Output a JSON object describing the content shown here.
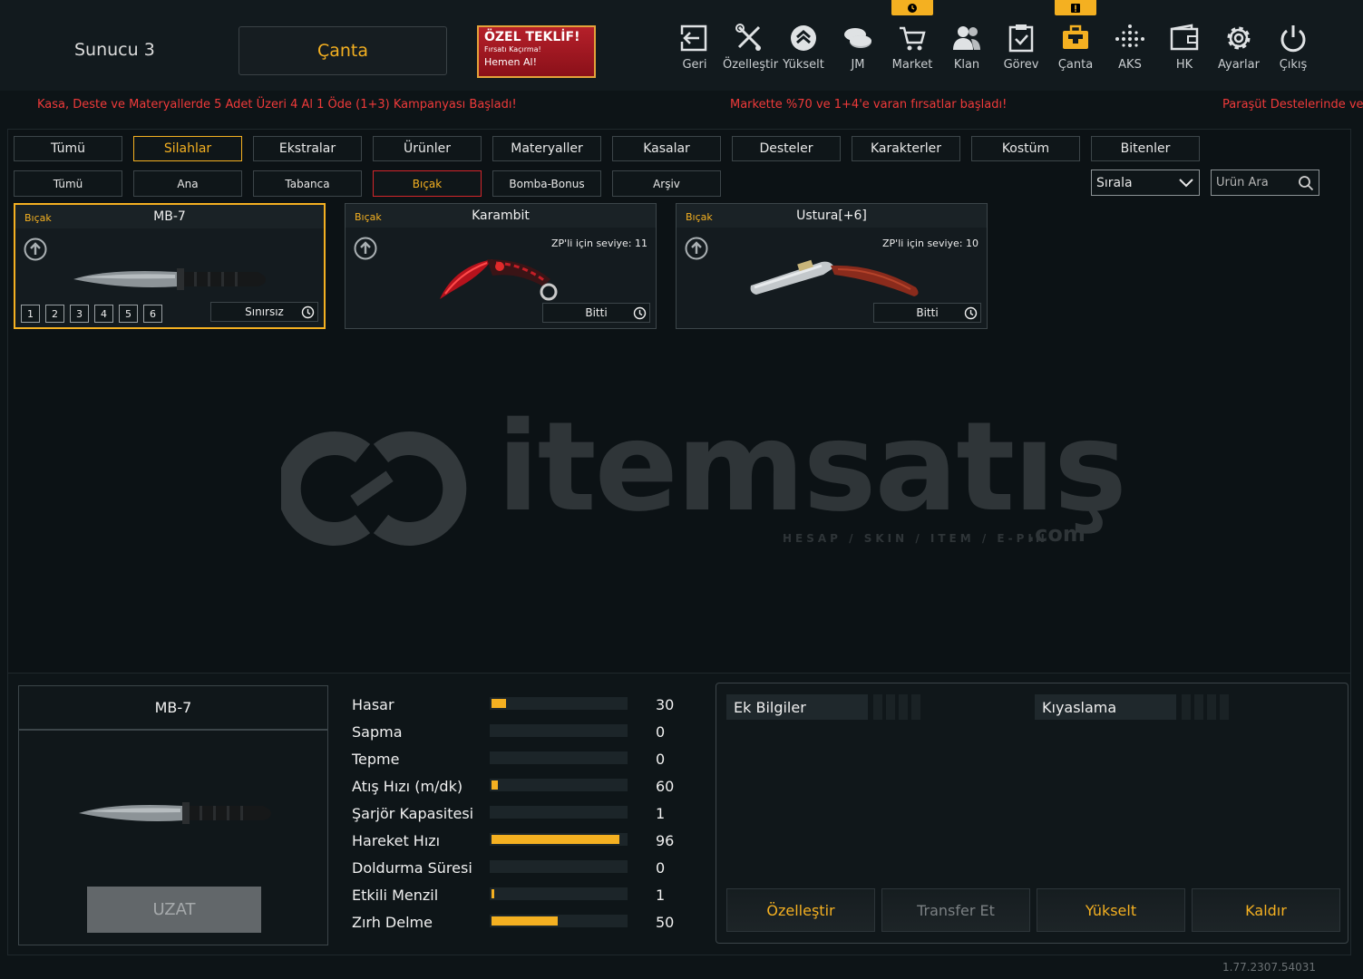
{
  "header": {
    "server": "Sunucu 3",
    "bag_title": "Çanta",
    "offer": {
      "line1": "ÖZEL TEKLİF!",
      "line2": "Fırsatı Kaçırma!",
      "line3": "Hemen Al!"
    }
  },
  "nav": [
    {
      "label": "Geri",
      "icon": "back-icon"
    },
    {
      "label": "Özelleştir",
      "icon": "tools-icon"
    },
    {
      "label": "Yükselt",
      "icon": "upgrade-icon"
    },
    {
      "label": "JM",
      "icon": "coins-icon"
    },
    {
      "label": "Market",
      "icon": "cart-icon"
    },
    {
      "label": "Klan",
      "icon": "clan-icon"
    },
    {
      "label": "Görev",
      "icon": "mission-icon"
    },
    {
      "label": "Çanta",
      "icon": "bag-icon"
    },
    {
      "label": "AKS",
      "icon": "aks-icon"
    },
    {
      "label": "HK",
      "icon": "wallet-icon"
    },
    {
      "label": "Ayarlar",
      "icon": "gear-icon"
    },
    {
      "label": "Çıkış",
      "icon": "power-icon"
    }
  ],
  "ticker": [
    "Kasa, Deste ve Materyallerde 5 Adet Üzeri 4 Al 1 Öde (1+3) Kampanyası Başladı!",
    "Markette %70 ve 1+4'e varan fırsatlar başladı!",
    "Paraşüt Destelerinde ve"
  ],
  "tabs": [
    "Tümü",
    "Silahlar",
    "Ekstralar",
    "Ürünler",
    "Materyaller",
    "Kasalar",
    "Desteler",
    "Karakterler",
    "Kostüm",
    "Bitenler"
  ],
  "subtabs": [
    "Tümü",
    "Ana",
    "Tabanca",
    "Bıçak",
    "Bomba-Bonus",
    "Arşiv"
  ],
  "sort_label": "Sırala",
  "search_placeholder": "Ürün Ara",
  "cards": [
    {
      "category": "Bıçak",
      "title": "MB-7",
      "level": "",
      "status": "Sınırsız",
      "slots": [
        "1",
        "2",
        "3",
        "4",
        "5",
        "6"
      ]
    },
    {
      "category": "Bıçak",
      "title": "Karambit",
      "level": "ZP'li için seviye: 11",
      "status": "Bitti"
    },
    {
      "category": "Bıçak",
      "title": "Ustura[+6]",
      "level": "ZP'li için seviye: 10",
      "status": "Bitti"
    }
  ],
  "watermark": {
    "brand": "itemsatış",
    "tagline": "HESAP / SKIN / ITEM / E-PIN",
    "suffix": ".com"
  },
  "preview": {
    "title": "MB-7",
    "button": "UZAT"
  },
  "stats": [
    {
      "label": "Hasar",
      "value": 30,
      "fill": 0.11
    },
    {
      "label": "Sapma",
      "value": 0,
      "fill": 0
    },
    {
      "label": "Tepme",
      "value": 0,
      "fill": 0
    },
    {
      "label": "Atış Hızı (m/dk)",
      "value": 60,
      "fill": 0.05
    },
    {
      "label": "Şarjör Kapasitesi",
      "value": 1,
      "fill": 0
    },
    {
      "label": "Hareket Hızı",
      "value": 96,
      "fill": 0.95
    },
    {
      "label": "Doldurma Süresi",
      "value": 0,
      "fill": 0
    },
    {
      "label": "Etkili Menzil",
      "value": 1,
      "fill": 0.01
    },
    {
      "label": "Zırh Delme",
      "value": 50,
      "fill": 0.49
    }
  ],
  "info": {
    "left_title": "Ek Bilgiler",
    "right_title": "Kıyaslama"
  },
  "actions": [
    {
      "label": "Özelleştir",
      "enabled": true
    },
    {
      "label": "Transfer Et",
      "enabled": false
    },
    {
      "label": "Yükselt",
      "enabled": true
    },
    {
      "label": "Kaldır",
      "enabled": true
    }
  ],
  "version": "1.77.2307.54031",
  "colors": {
    "accent": "#f4b021",
    "ticker": "#ef3a3a",
    "background": "#0d1417"
  }
}
